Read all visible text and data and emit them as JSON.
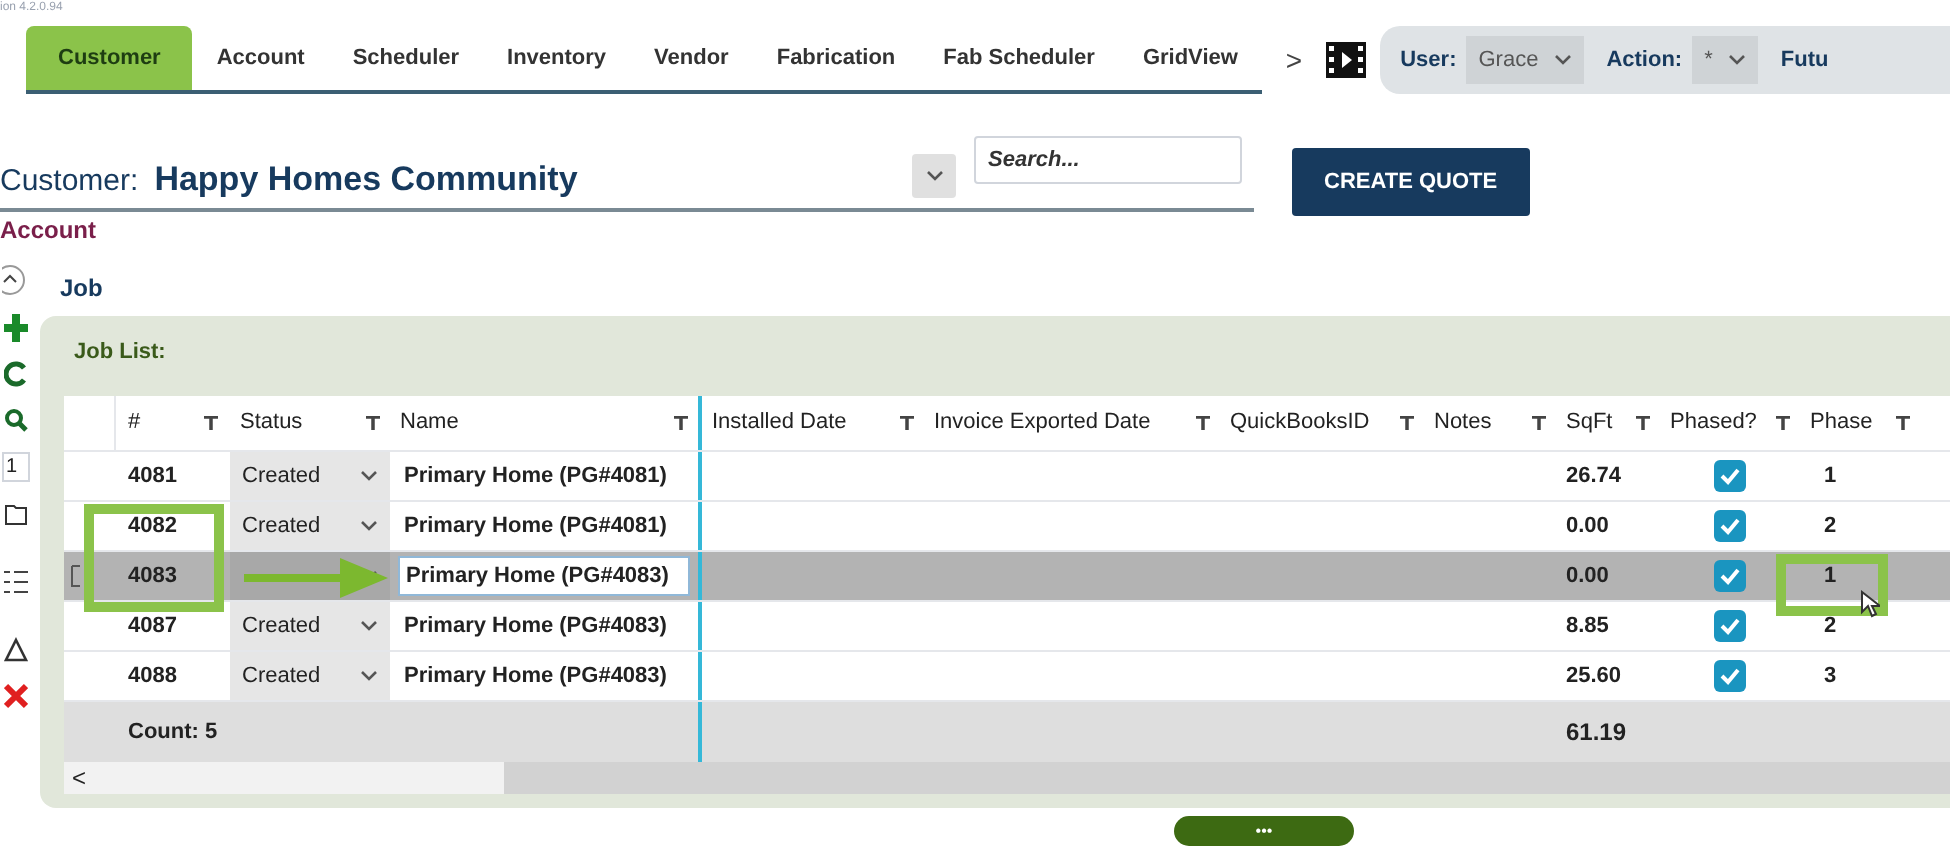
{
  "version": "ion 4.2.0.94",
  "tabs": [
    {
      "label": "Customer",
      "selected": true
    },
    {
      "label": "Account",
      "selected": false
    },
    {
      "label": "Scheduler",
      "selected": false
    },
    {
      "label": "Inventory",
      "selected": false
    },
    {
      "label": "Vendor",
      "selected": false
    },
    {
      "label": "Fabrication",
      "selected": false
    },
    {
      "label": "Fab Scheduler",
      "selected": false
    },
    {
      "label": "GridView",
      "selected": false
    }
  ],
  "tab_more": ">",
  "user_bar": {
    "user_label": "User:",
    "user_value": "Grace",
    "action_label": "Action:",
    "action_value": "*",
    "cut_label": "Futu"
  },
  "customer": {
    "label": "Customer:",
    "value": "Happy Homes Community"
  },
  "search": {
    "placeholder": "Search..."
  },
  "create_button": "CREATE QUOTE",
  "account_link": "Account",
  "job_label": "Job",
  "left_toolbar": {
    "page_value": "1"
  },
  "job_list": {
    "title": "Job List:",
    "columns": [
      "#",
      "Status",
      "Name",
      "Installed Date",
      "Invoice Exported Date",
      "QuickBooksID",
      "Notes",
      "SqFt",
      "Phased?",
      "Phase"
    ],
    "rows": [
      {
        "num": "4081",
        "status": "Created",
        "name": "Primary Home (PG#4081)",
        "sqft": "26.74",
        "phased": true,
        "phase": "1",
        "selected": false,
        "editing": false
      },
      {
        "num": "4082",
        "status": "Created",
        "name": "Primary Home (PG#4081)",
        "sqft": "0.00",
        "phased": true,
        "phase": "2",
        "selected": false,
        "editing": false
      },
      {
        "num": "4083",
        "name": "Primary Home (PG#4083)",
        "sqft": "0.00",
        "phased": true,
        "phase": "1",
        "selected": true,
        "editing": true
      },
      {
        "num": "4087",
        "status": "Created",
        "name": "Primary Home (PG#4083)",
        "sqft": "8.85",
        "phased": true,
        "phase": "2",
        "selected": false,
        "editing": false
      },
      {
        "num": "4088",
        "status": "Created",
        "name": "Primary Home (PG#4083)",
        "sqft": "25.60",
        "phased": true,
        "phase": "3",
        "selected": false,
        "editing": false
      }
    ],
    "footer": {
      "count": "Count: 5",
      "sqft_total": "61.19"
    },
    "scroll_left": "<"
  },
  "more_button": "•••"
}
